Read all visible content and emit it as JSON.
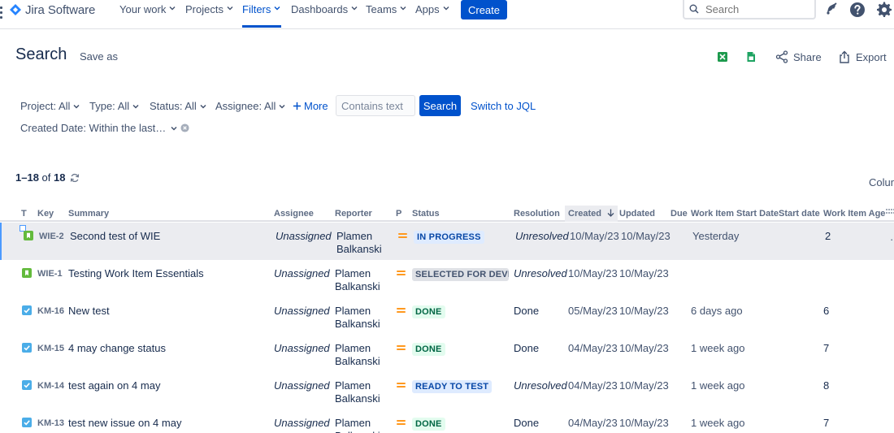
{
  "nav": {
    "logo_text": "Jira Software",
    "items": [
      {
        "label": "Your work"
      },
      {
        "label": "Projects"
      },
      {
        "label": "Filters"
      },
      {
        "label": "Dashboards"
      },
      {
        "label": "Teams"
      },
      {
        "label": "Apps"
      }
    ],
    "active_item": "Filters",
    "create_label": "Create",
    "search_placeholder": "Search"
  },
  "header": {
    "title": "Search",
    "save_as_label": "Save as",
    "share_label": "Share",
    "export_label": "Export"
  },
  "filters": {
    "project": "Project: All",
    "type": "Type: All",
    "status": "Status: All",
    "assignee": "Assignee: All",
    "more_label": "More",
    "text_placeholder": "Contains text",
    "search_button": "Search",
    "switch_jql": "Switch to JQL",
    "created_date": "Created Date: Within the last…"
  },
  "results": {
    "range": "1–18",
    "of_label": "of",
    "total": "18",
    "columns_label": "Columns"
  },
  "table": {
    "headers": {
      "type": "T",
      "key": "Key",
      "summary": "Summary",
      "assignee": "Assignee",
      "reporter": "Reporter",
      "priority": "P",
      "status": "Status",
      "resolution": "Resolution",
      "created": "Created",
      "updated": "Updated",
      "due": "Due",
      "wi_start": "Work Item Start Date",
      "start_date": "Start date",
      "wi_age": "Work Item Age"
    },
    "rows": [
      {
        "type_icon": "story-icon",
        "key": "WIE-2",
        "summary": "Second test of WIE",
        "assignee": "Unassigned",
        "reporter": "Plamen Balkanski",
        "status": "IN PROGRESS",
        "status_color": "blue",
        "resolution": "Unresolved",
        "created": "10/May/23",
        "updated": "10/May/23",
        "wi_start": "Yesterday",
        "wi_age": "2"
      },
      {
        "type_icon": "story-icon",
        "key": "WIE-1",
        "summary": "Testing Work Item Essentials",
        "assignee": "Unassigned",
        "reporter": "Plamen Balkanski",
        "status": "SELECTED FOR DEVELOPMENT",
        "status_color": "grey",
        "resolution": "Unresolved",
        "created": "10/May/23",
        "updated": "10/May/23",
        "wi_start": "",
        "wi_age": ""
      },
      {
        "type_icon": "task-icon",
        "key": "KM-16",
        "summary": "New test",
        "assignee": "Unassigned",
        "reporter": "Plamen Balkanski",
        "status": "DONE",
        "status_color": "green",
        "resolution": "Done",
        "created": "05/May/23",
        "updated": "10/May/23",
        "wi_start": "6 days ago",
        "wi_age": "6"
      },
      {
        "type_icon": "task-icon",
        "key": "KM-15",
        "summary": "4 may change status",
        "assignee": "Unassigned",
        "reporter": "Plamen Balkanski",
        "status": "DONE",
        "status_color": "green",
        "resolution": "Done",
        "created": "04/May/23",
        "updated": "10/May/23",
        "wi_start": "1 week ago",
        "wi_age": "7"
      },
      {
        "type_icon": "task-icon",
        "key": "KM-14",
        "summary": "test again on 4 may",
        "assignee": "Unassigned",
        "reporter": "Plamen Balkanski",
        "status": "READY TO TEST",
        "status_color": "blue",
        "resolution": "Unresolved",
        "created": "04/May/23",
        "updated": "10/May/23",
        "wi_start": "1 week ago",
        "wi_age": "8"
      },
      {
        "type_icon": "task-icon",
        "key": "KM-13",
        "summary": "test new issue on 4 may",
        "assignee": "Unassigned",
        "reporter": "Plamen Balkanski",
        "status": "DONE",
        "status_color": "green",
        "resolution": "Done",
        "created": "04/May/23",
        "updated": "10/May/23",
        "wi_start": "1 week ago",
        "wi_age": "7"
      }
    ]
  },
  "colors": {
    "brand": "#0052cc",
    "story": "#63ba3c",
    "task": "#4bade8",
    "priority_medium": "#ff991f"
  }
}
